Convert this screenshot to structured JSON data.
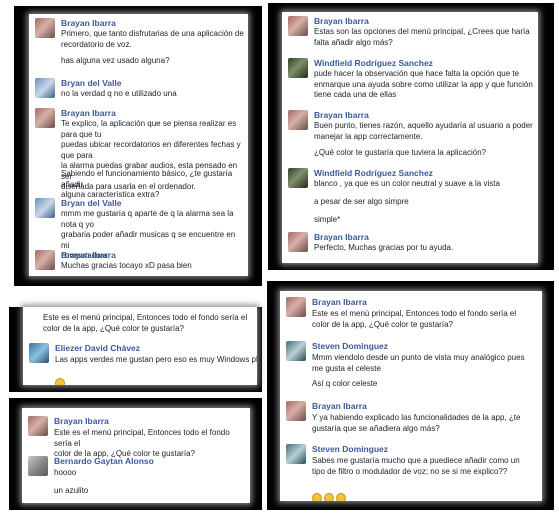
{
  "panel1": {
    "m1": {
      "name": "Brayan Ibarra",
      "text": "Primero, que tanto disfrutarias de una aplicación de\nrecordatorio de voz."
    },
    "m1b": {
      "text": "has alguna vez usado alguna?"
    },
    "m2": {
      "name": "Bryan del Valle",
      "text": "no la verdad q no e utilizado una"
    },
    "m3": {
      "name": "Brayan Ibarra",
      "text": "Te explico, la aplicación que se piensa realizar es para que tu\npuedas ubicar recordatorios en diferentes fechas y que para\nla alarma puedas grabar audios, esta pensado en ser\ndiseñada para usarla en el ordenador."
    },
    "m3b": {
      "text": "Sabiendo el funcionamiento básico, ¿te gustaría añadir\nalguna característica extra?"
    },
    "m4": {
      "name": "Bryan del Valle",
      "text": "mmm me gustaría q aparte de q la alarma sea la nota q yo\ngrabaria poder añadir musicas q se encuentre en mi\ncomputadora"
    },
    "m5": {
      "name": "Brayan Ibarra",
      "text": "Muchas gracias tocayo xD pasa bien"
    }
  },
  "panel2": {
    "m1": {
      "name": "Brayan Ibarra",
      "text": "Estas son las opciones del menú principal, ¿Crees que haría\nfalta añadir algo más?"
    },
    "m2": {
      "name": "Windfield Rodríguez Sanchez",
      "text": "pude hacer la observación que hace falta la opción que te\nenmarque una ayuda sobre como utilizar la app y que función\ntiene cada una de ellas"
    },
    "m3": {
      "name": "Brayan Ibarra",
      "text": "Buen punto, tienes razón, aquello ayudaría al usuario a poder\nmanejar la app correctamente."
    },
    "m3b": {
      "text": "¿Qué color te gustaría que tuviera la aplicación?"
    },
    "m4": {
      "name": "Windfield Rodríguez Sanchez",
      "text": "blanco , ya que es un color neutral y suave a la vista"
    },
    "m4b": {
      "text": "a pesar de ser algo simpre"
    },
    "m4c": {
      "text": "simple*"
    },
    "m5": {
      "name": "Brayan Ibarra",
      "text": "Perfecto, Muchas gracias por tu ayuda."
    }
  },
  "panel3": {
    "m0": {
      "text": "Este es el menú principal, Entonces todo el fondo sería el\ncolor de la app, ¿Qué color te gustaría?"
    },
    "m1": {
      "name": "Eliezer David Chávez",
      "text": "Las apps verdes me gustan pero eso es muy Windows phone"
    }
  },
  "panel4": {
    "m1": {
      "name": "Brayan Ibarra",
      "text": "Este es el menú principal, Entonces todo el fondo sería el\ncolor de la app, ¿Qué color te gustaría?"
    },
    "m2": {
      "name": "Bernardo Gaytan Alonso",
      "text": "hoooo"
    },
    "m2b": {
      "text": "un azulito"
    }
  },
  "panel5": {
    "m1": {
      "name": "Brayan Ibarra",
      "text": "Este es el menú principal, Entonces todo el fondo sería el\ncolor de la app, ¿Qué color te gustaría?"
    },
    "m2": {
      "name": "Steven Dominguez",
      "text": "Mmm viendolo desde un punto de vista muy analógico  pues\nme gusta el celeste"
    },
    "m2b": {
      "text": "Así q color celeste"
    },
    "m3": {
      "name": "Brayan Ibarra",
      "text": "Y ya habiendo explicado las funcionalidades de la app, ¿te\ngustaría que se añadiera algo más?"
    },
    "m4": {
      "name": "Steven Dominguez",
      "text": "Sabes me gustaría  mucho que a puediece añadir como un\ntipo de filtro o modulador de voz; no se si me explico??"
    }
  },
  "colors": {
    "name": "#3b5998",
    "text": "#1d2129",
    "frame": "#000000"
  }
}
